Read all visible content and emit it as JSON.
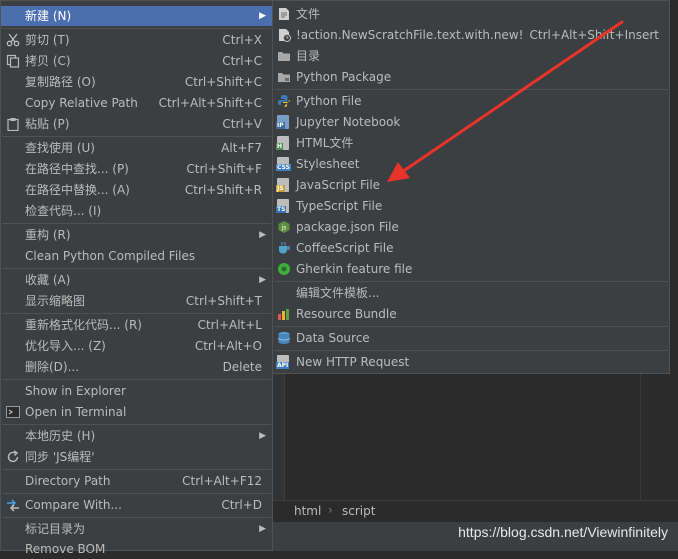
{
  "context_menu": {
    "items": [
      {
        "label": "新建 (N)",
        "shortcut": "",
        "submenu": true,
        "selected": true,
        "icon": ""
      },
      {
        "label": "剪切 (T)",
        "shortcut": "Ctrl+X",
        "icon": "scissors-icon"
      },
      {
        "label": "拷贝 (C)",
        "shortcut": "Ctrl+C",
        "icon": "copy-icon"
      },
      {
        "label": "复制路径 (O)",
        "shortcut": "Ctrl+Shift+C",
        "icon": ""
      },
      {
        "label": "Copy Relative Path",
        "shortcut": "Ctrl+Alt+Shift+C",
        "icon": ""
      },
      {
        "label": "粘贴 (P)",
        "shortcut": "Ctrl+V",
        "icon": "paste-icon"
      },
      {
        "label": "查找使用 (U)",
        "shortcut": "Alt+F7",
        "icon": ""
      },
      {
        "label": "在路径中查找... (P)",
        "shortcut": "Ctrl+Shift+F",
        "icon": ""
      },
      {
        "label": "在路径中替换... (A)",
        "shortcut": "Ctrl+Shift+R",
        "icon": ""
      },
      {
        "label": "检查代码... (I)",
        "shortcut": "",
        "icon": ""
      },
      {
        "label": "重构 (R)",
        "shortcut": "",
        "submenu": true,
        "icon": ""
      },
      {
        "label": "Clean Python Compiled Files",
        "shortcut": "",
        "icon": ""
      },
      {
        "label": "收藏 (A)",
        "shortcut": "",
        "submenu": true,
        "icon": ""
      },
      {
        "label": "显示缩略图",
        "shortcut": "Ctrl+Shift+T",
        "icon": ""
      },
      {
        "label": "重新格式化代码... (R)",
        "shortcut": "Ctrl+Alt+L",
        "icon": ""
      },
      {
        "label": "优化导入... (Z)",
        "shortcut": "Ctrl+Alt+O",
        "icon": ""
      },
      {
        "label": "删除(D)...",
        "shortcut": "Delete",
        "icon": ""
      },
      {
        "label": "Show in Explorer",
        "shortcut": "",
        "icon": ""
      },
      {
        "label": "Open in Terminal",
        "shortcut": "",
        "icon": "terminal-icon"
      },
      {
        "label": "本地历史 (H)",
        "shortcut": "",
        "submenu": true,
        "icon": ""
      },
      {
        "label": "同步 'JS编程'",
        "shortcut": "",
        "icon": "sync-icon"
      },
      {
        "label": "Directory Path",
        "shortcut": "Ctrl+Alt+F12",
        "icon": ""
      },
      {
        "label": "Compare With...",
        "shortcut": "Ctrl+D",
        "icon": "compare-icon"
      },
      {
        "label": "标记目录为",
        "shortcut": "",
        "submenu": true,
        "icon": ""
      },
      {
        "label": "Remove BOM",
        "shortcut": "",
        "icon": ""
      }
    ]
  },
  "new_submenu": {
    "items": [
      {
        "label": "文件",
        "shortcut": "",
        "icon": "file-icon"
      },
      {
        "label": "!action.NewScratchFile.text.with.new!",
        "shortcut": "Ctrl+Alt+Shift+Insert",
        "icon": "scratch-file-icon"
      },
      {
        "label": "目录",
        "shortcut": "",
        "icon": "folder-icon"
      },
      {
        "label": "Python Package",
        "shortcut": "",
        "icon": "package-icon"
      },
      {
        "label": "Python File",
        "shortcut": "",
        "icon": "python-file-icon"
      },
      {
        "label": "Jupyter Notebook",
        "shortcut": "",
        "icon": "jupyter-icon"
      },
      {
        "label": "HTML文件",
        "shortcut": "",
        "icon": "html-file-icon"
      },
      {
        "label": "Stylesheet",
        "shortcut": "",
        "icon": "css-file-icon"
      },
      {
        "label": "JavaScript File",
        "shortcut": "",
        "icon": "js-file-icon"
      },
      {
        "label": "TypeScript File",
        "shortcut": "",
        "icon": "ts-file-icon"
      },
      {
        "label": "package.json File",
        "shortcut": "",
        "icon": "package-json-icon"
      },
      {
        "label": "CoffeeScript File",
        "shortcut": "",
        "icon": "coffeescript-icon"
      },
      {
        "label": "Gherkin feature file",
        "shortcut": "",
        "icon": "gherkin-icon"
      },
      {
        "label": "编辑文件模板...",
        "shortcut": "",
        "icon": ""
      },
      {
        "label": "Resource Bundle",
        "shortcut": "",
        "icon": "resource-bundle-icon"
      },
      {
        "label": "Data Source",
        "shortcut": "",
        "icon": "database-icon"
      },
      {
        "label": "New HTTP Request",
        "shortcut": "",
        "icon": "api-icon"
      }
    ]
  },
  "breadcrumb": {
    "items": [
      "html",
      "script"
    ]
  },
  "watermark": "https://blog.csdn.net/Viewinfinitely",
  "colors": {
    "menu_bg": "#3c3f41",
    "selection": "#4b6eaf",
    "editor_bg": "#2b2b2b",
    "annotation_arrow": "#e8332a"
  }
}
